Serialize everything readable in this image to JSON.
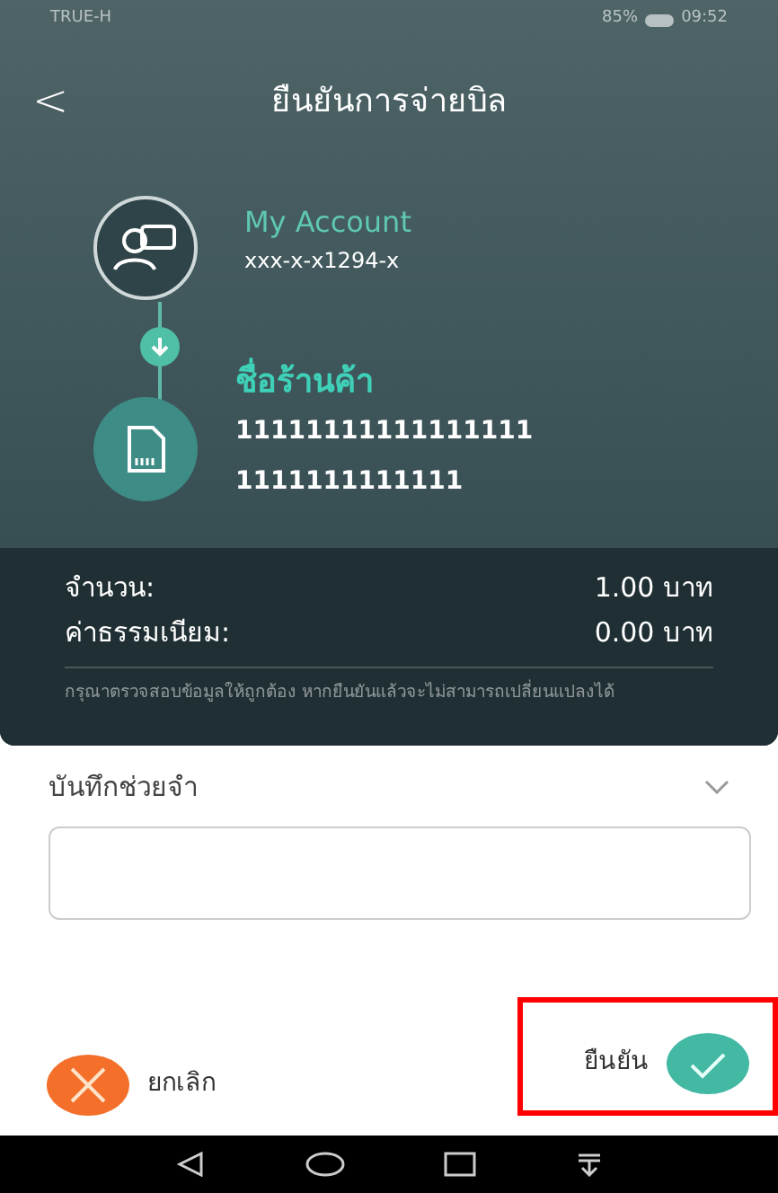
{
  "status_bar": {
    "carrier": "TRUE-H",
    "battery": "85%",
    "time": "09:52"
  },
  "header": {
    "back": "<",
    "title": "ยืนยันการจ่ายบิล"
  },
  "from": {
    "name": "My Account",
    "number": "xxx-x-x1294-x"
  },
  "to": {
    "name": "ชื่อร้านค้า",
    "lines": [
      "11111111111111111",
      "1111111111111"
    ]
  },
  "summary": [
    {
      "label": "จำนวน:",
      "value": "1.00 บาท"
    },
    {
      "label": "ค่าธรรมเนียม:",
      "value": "0.00 บาท"
    }
  ],
  "notice": "กรุณาตรวจสอบข้อมูลให้ถูกต้อง หากยืนยันแล้วจะไม่สามารถเปลี่ยนแปลงได้",
  "memo": {
    "label": "บันทึกช่วยจำ",
    "expanded": false
  },
  "actions": {
    "cancel": "ยกเลิก",
    "confirm": "ยืนยัน",
    "confirm_highlighted": true
  }
}
